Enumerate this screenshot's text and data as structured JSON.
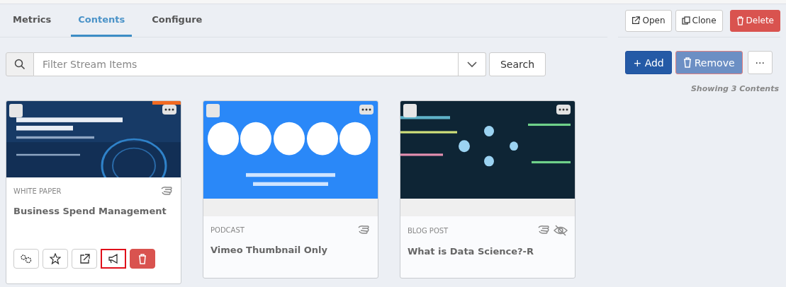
{
  "tabs": [
    {
      "label": "Metrics",
      "selected": false
    },
    {
      "label": "Contents",
      "selected": true
    },
    {
      "label": "Configure",
      "selected": false
    }
  ],
  "header_actions": [
    {
      "kind": "open",
      "label": "Open"
    },
    {
      "kind": "clone",
      "label": "Clone"
    },
    {
      "kind": "delete",
      "label": "Delete"
    }
  ],
  "search": {
    "placeholder": "Filter Stream Items",
    "button": "Search"
  },
  "list_actions": [
    {
      "kind": "add",
      "label": "+ Add",
      "disabled": false
    },
    {
      "kind": "remove",
      "label": "Remove",
      "disabled": true
    },
    {
      "kind": "more",
      "label": "···",
      "disabled": false
    }
  ],
  "summary": "Showing 3 Contents",
  "cards": [
    {
      "type": "WHITE PAPER",
      "title": "Business Spend Management",
      "checked": false,
      "hidden": false,
      "thumbnail": {
        "kind": "picture",
        "letterboxed": false
      },
      "actions": [
        {
          "kind": "settings",
          "highlighted": false
        },
        {
          "kind": "star",
          "highlighted": false
        },
        {
          "kind": "external",
          "highlighted": false
        },
        {
          "kind": "promote",
          "highlighted": true
        },
        {
          "kind": "delete",
          "highlighted": false
        }
      ]
    },
    {
      "type": "PODCAST",
      "title": "Vimeo Thumbnail Only",
      "checked": false,
      "hidden": false,
      "thumbnail": {
        "kind": "picture",
        "letterboxed": true
      }
    },
    {
      "type": "BLOG POST",
      "title": "What is Data Science?-R",
      "checked": false,
      "hidden": true,
      "thumbnail": {
        "kind": "picture",
        "letterboxed": true
      }
    }
  ]
}
